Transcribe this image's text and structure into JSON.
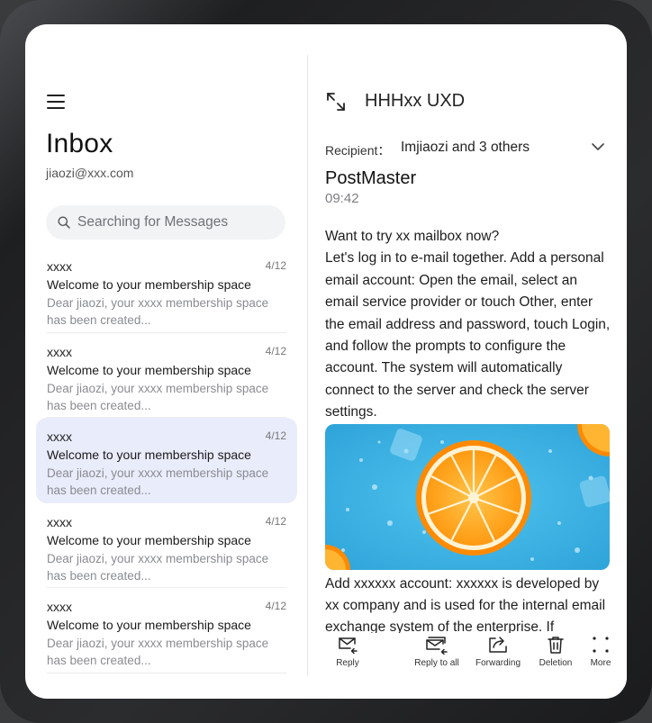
{
  "sidebar": {
    "title": "Inbox",
    "account": "jiaozi@xxx.com",
    "search_placeholder": "Searching for Messages",
    "messages": [
      {
        "sender": "xxxx",
        "date": "4/12",
        "subject": "Welcome to your membership space",
        "preview": "Dear jiaozi, your xxxx membership space has been created...",
        "selected": false
      },
      {
        "sender": "xxxx",
        "date": "4/12",
        "subject": "Welcome to your membership space",
        "preview": "Dear jiaozi, your xxxx membership space has been created...",
        "selected": false
      },
      {
        "sender": "xxxx",
        "date": "4/12",
        "subject": "Welcome to your membership space",
        "preview": "Dear jiaozi, your xxxx membership space has been created...",
        "selected": true
      },
      {
        "sender": "xxxx",
        "date": "4/12",
        "subject": "Welcome to your membership space",
        "preview": "Dear jiaozi, your xxxx membership space has been created...",
        "selected": false
      },
      {
        "sender": "xxxx",
        "date": "4/12",
        "subject": "Welcome to your membership space",
        "preview": "Dear jiaozi, your xxxx membership space has been created...",
        "selected": false
      }
    ]
  },
  "mail": {
    "title": "HHHxx UXD",
    "recipient_label": "Recipient：",
    "recipient_value": "Imjiaozi and 3 others",
    "from": "PostMaster",
    "time": "09:42",
    "para1": "Want to try xx mailbox now?",
    "para2": "Let's log in to e-mail together. Add a personal email account: Open the email, select an email service provider or touch Other, enter the email address and password, touch Login, and follow the prompts to configure the account. The system will automatically connect to the server and check the server settings.",
    "para3": "Add xxxxxx account: xxxxxx is developed by xx company and is used for the internal email exchange system of the enterprise. If"
  },
  "toolbar": {
    "reply": "Reply",
    "reply_all": "Reply to all",
    "forward": "Forwarding",
    "delete": "Deletion",
    "more": "More"
  },
  "icons": {
    "menu": "menu-icon",
    "search": "search-icon",
    "expand": "expand-icon",
    "chevron": "chevron-down-icon",
    "reply": "reply-icon",
    "reply_all": "reply-all-icon",
    "forward": "forward-icon",
    "delete": "trash-icon",
    "more": "more-dots-icon"
  },
  "colors": {
    "selected_row": "#e9ecfb",
    "screen": "#ffffff",
    "search_bg": "#f1f3f5"
  }
}
